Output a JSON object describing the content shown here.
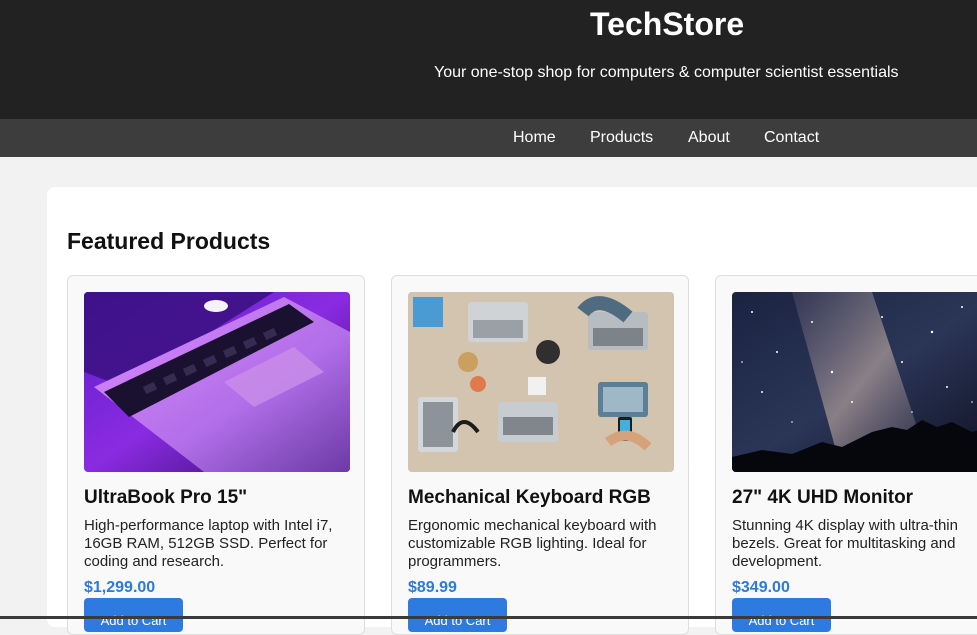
{
  "header": {
    "title": "TechStore",
    "tagline": "Your one-stop shop for computers & computer scientist essentials"
  },
  "nav": {
    "items": [
      "Home",
      "Products",
      "About",
      "Contact"
    ]
  },
  "main": {
    "section_title": "Featured Products",
    "products": [
      {
        "name": "UltraBook Pro 15\"",
        "description": "High-performance laptop with Intel i7, 16GB RAM, 512GB SSD. Perfect for coding and research.",
        "price": "$1,299.00",
        "button": "Add to Cart"
      },
      {
        "name": "Mechanical Keyboard RGB",
        "description": "Ergonomic mechanical keyboard with customizable RGB lighting. Ideal for programmers.",
        "price": "$89.99",
        "button": "Add to Cart"
      },
      {
        "name": "27\" 4K UHD Monitor",
        "description": "Stunning 4K display with ultra-thin bezels. Great for multitasking and development.",
        "price": "$349.00",
        "button": "Add to Cart"
      }
    ]
  },
  "colors": {
    "header_bg": "#222222",
    "nav_bg": "#3d3d3d",
    "page_bg": "#f2f2f2",
    "price": "#2d7bd6",
    "button": "#2d7be0"
  }
}
